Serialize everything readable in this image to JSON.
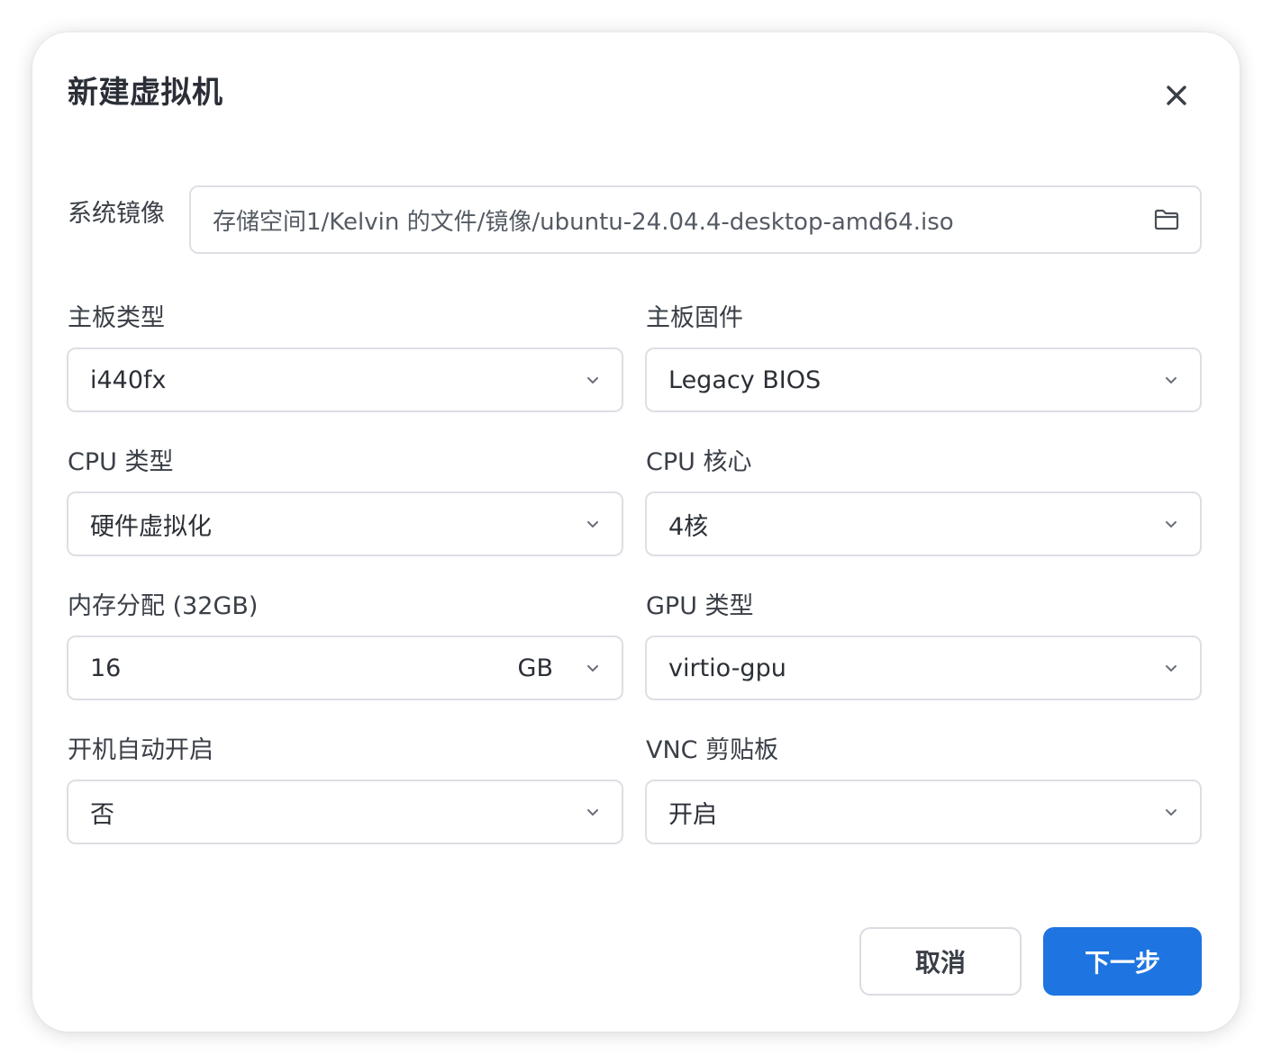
{
  "dialog": {
    "title": "新建虚拟机"
  },
  "system_image": {
    "label": "系统镜像",
    "value": "存储空间1/Kelvin 的文件/镜像/ubuntu-24.04.4-desktop-amd64.iso",
    "icon": "folder-icon"
  },
  "board_type": {
    "label": "主板类型",
    "value": "i440fx"
  },
  "board_firmware": {
    "label": "主板固件",
    "value": "Legacy BIOS"
  },
  "cpu_type": {
    "label": "CPU 类型",
    "value": "硬件虚拟化"
  },
  "cpu_cores": {
    "label": "CPU 核心",
    "value": "4核"
  },
  "memory": {
    "label": "内存分配 (32GB)",
    "value": "16",
    "unit": "GB"
  },
  "gpu_type": {
    "label": "GPU 类型",
    "value": "virtio-gpu"
  },
  "autostart": {
    "label": "开机自动开启",
    "value": "否"
  },
  "vnc_clipboard": {
    "label": "VNC 剪贴板",
    "value": "开启"
  },
  "buttons": {
    "cancel": "取消",
    "next": "下一步"
  },
  "colors": {
    "primary": "#1e74e0",
    "border": "#dcdfe4",
    "text": "#2b2f36"
  }
}
